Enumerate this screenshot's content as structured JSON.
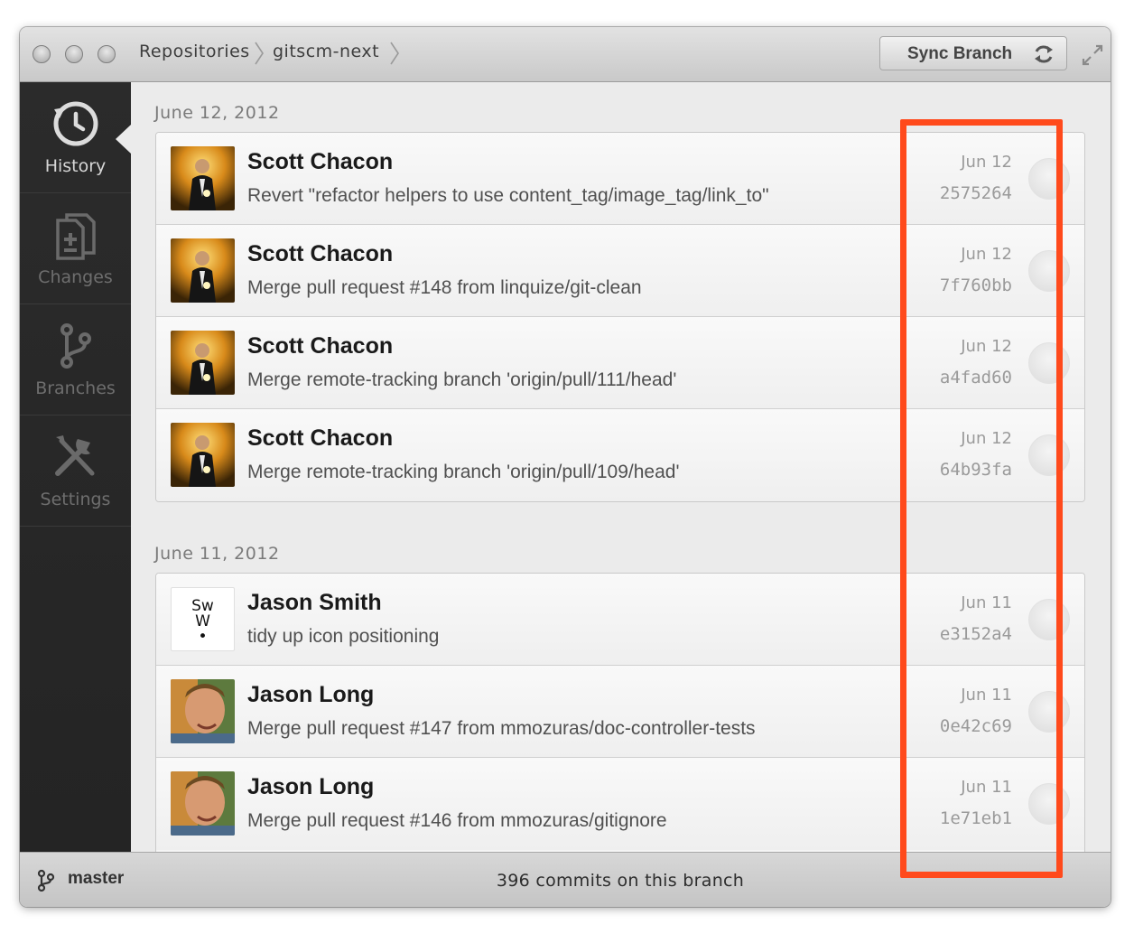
{
  "titlebar": {
    "breadcrumb": [
      "Repositories",
      "gitscm-next"
    ],
    "sync_label": "Sync Branch",
    "sync_icon": "sync-icon",
    "fullscreen_icon": "fullscreen-icon"
  },
  "sidebar": {
    "items": [
      {
        "label": "History",
        "icon": "history-icon",
        "active": true
      },
      {
        "label": "Changes",
        "icon": "changes-icon",
        "active": false
      },
      {
        "label": "Branches",
        "icon": "branches-icon",
        "active": false
      },
      {
        "label": "Settings",
        "icon": "settings-icon",
        "active": false
      }
    ]
  },
  "history": [
    {
      "date": "June 12, 2012",
      "commits": [
        {
          "author": "Scott Chacon",
          "message": "Revert \"refactor helpers to use content_tag/image_tag/link_to\"",
          "date": "Jun 12",
          "sha": "2575264"
        },
        {
          "author": "Scott Chacon",
          "message": "Merge pull request #148 from linquize/git-clean",
          "date": "Jun 12",
          "sha": "7f760bb"
        },
        {
          "author": "Scott Chacon",
          "message": "Merge remote-tracking branch 'origin/pull/111/head'",
          "date": "Jun 12",
          "sha": "a4fad60"
        },
        {
          "author": "Scott Chacon",
          "message": "Merge remote-tracking branch 'origin/pull/109/head'",
          "date": "Jun 12",
          "sha": "64b93fa"
        }
      ]
    },
    {
      "date": "June 11, 2012",
      "commits": [
        {
          "author": "Jason Smith",
          "message": "tidy up icon positioning",
          "date": "Jun 11",
          "sha": "e3152a4"
        },
        {
          "author": "Jason Long",
          "message": "Merge pull request #147 from mmozuras/doc-controller-tests",
          "date": "Jun 11",
          "sha": "0e42c69"
        },
        {
          "author": "Jason Long",
          "message": "Merge pull request #146 from mmozuras/gitignore",
          "date": "Jun 11",
          "sha": "1e71eb1"
        }
      ]
    }
  ],
  "avatar_badge": {
    "line1": "Sw",
    "line2": "W",
    "line3": "•"
  },
  "statusbar": {
    "branch": "master",
    "commit_count": "396 commits on this branch"
  },
  "colors": {
    "highlight": "#ff4a1c",
    "sidebar": "#282828"
  }
}
